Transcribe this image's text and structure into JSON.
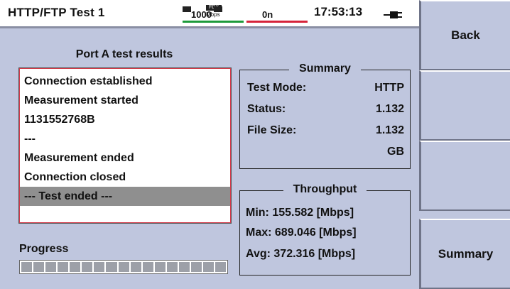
{
  "header": {
    "title": "HTTP/FTP Test 1",
    "link_speed": "1000",
    "duplex": "FDX",
    "speed_unit": "Mbps",
    "port_state": "0n",
    "time": "17:53:13",
    "link_bar_color": "#1d9a3a",
    "port_bar_color": "#d6243a"
  },
  "softkeys": {
    "back": "Back",
    "summary": "Summary"
  },
  "results": {
    "title": "Port A test results",
    "lines": [
      "Connection established",
      "Measurement started",
      "1131552768B",
      "---",
      "Measurement ended",
      "Connection closed",
      "--- Test ended ---"
    ],
    "selected_index": 6
  },
  "progress": {
    "label": "Progress",
    "fraction": 0.0
  },
  "summary": {
    "title": "Summary",
    "test_mode_label": "Test Mode:",
    "test_mode_value": "HTTP",
    "status_label": "Status:",
    "status_value": "1.132",
    "file_size_label": "File Size:",
    "file_size_value": "1.132",
    "file_size_unit": "GB"
  },
  "throughput": {
    "title": "Throughput",
    "min": "Min:  155.582 [Mbps]",
    "max": "Max: 689.046 [Mbps]",
    "avg": "Avg:  372.316 [Mbps]"
  }
}
